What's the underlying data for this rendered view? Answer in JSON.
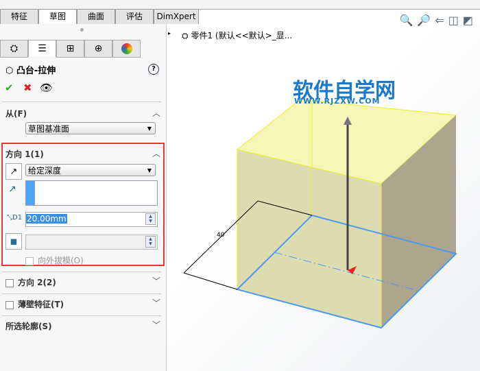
{
  "tabs": [
    "特征",
    "草图",
    "曲面",
    "评估",
    "DimXpert"
  ],
  "panel": {
    "title": "凸台-拉伸",
    "from": {
      "label": "从(F)",
      "value": "草图基准面"
    },
    "dir1": {
      "label": "方向 1(1)",
      "end_condition": "给定深度",
      "depth": "20.00mm",
      "draft_outward": "向外拔模(O)"
    },
    "dir2": "方向 2(2)",
    "thin": "薄壁特征(T)",
    "contours": "所选轮廓(S)"
  },
  "viewport": {
    "tree_label": "零件1  (默认<<默认>_显...",
    "watermark": "软件自学网",
    "watermark_url": "WWW.RJZXW.COM"
  },
  "colors": {
    "highlight": "#e53935",
    "accent": "#1a7ac9"
  }
}
